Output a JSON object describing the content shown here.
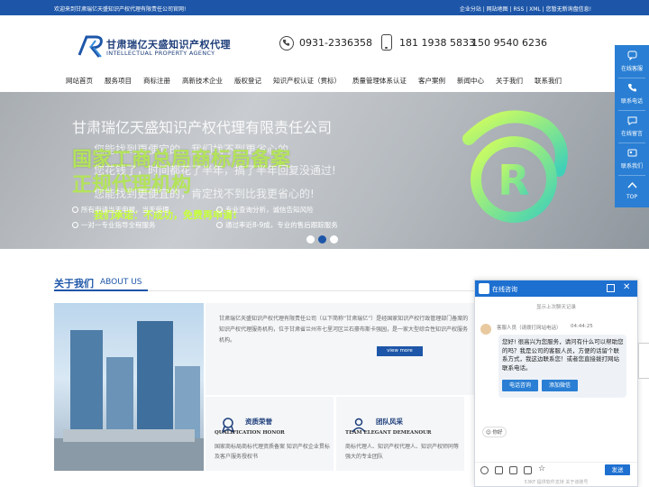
{
  "topbar": {
    "welcome": "欢迎来到甘肃瑞亿天盛知识产权代理有限责任公司官网!",
    "links": "企业分站 | 网站地图 | RSS | XML | 您暂无新询盘信息!"
  },
  "header": {
    "logo_cn": "甘肃瑞亿天盛知识产权代理",
    "logo_en": "INTELLECTUAL PROPERTY AGENCY",
    "phone1": "0931-2336358",
    "phone2": "181 1938 5833",
    "phone3": "150 9540 6236"
  },
  "nav": [
    "网站首页",
    "服务项目",
    "商标注册",
    "高新技术企业",
    "版权登记",
    "知识产权认证（贯标）",
    "质量管理体系认证",
    "客户案例",
    "新闻中心",
    "关于我们",
    "联系我们"
  ],
  "banner": {
    "line1": "甘肃瑞亿天盛知识产权代理有限责任公司",
    "line2": "国家工商总局商标局备案",
    "line3": "正规代理机构",
    "sub1": "您能找到更便宜的，我们找不到更省心的",
    "sub2": "您花钱了，时间都花了半年，搞了半年回复没通过!",
    "sub3": "您能找到更便宜的，肯定找不到比我更省心的!",
    "tag": "我们承诺：不成功，免费再申请!",
    "bullets": [
      "所有申请当天申报，当天受理",
      "专业查询分析，诚信告知风险",
      "一对一专业指导全程服务",
      "通过率近8-9成，专业的售后跟踪服务"
    ],
    "seal_text": "R",
    "slides": 3,
    "active_slide": 2
  },
  "about": {
    "title": "关于我们",
    "title_en": "ABOUT US",
    "text": "甘肃瑞亿天盛知识产权代理有限责任公司（以下简称“甘肃瑞亿”）是经国家知识产权行政管理部门备案的知识产权代理服务机构，位于甘肃省兰州市七里河区兰石豪布斯卡强园，是一家大型综合性知识产权服务机构。",
    "view_more": "view more",
    "cards": [
      {
        "title": "资质荣誉",
        "en": "QUALIFICATION HONOR",
        "desc": "国家商标局商标代理资质备案 知识产权企业贯标及客户服务授权书"
      },
      {
        "title": "团队风采",
        "en": "TEAM ELEGANT DEMEANOUR",
        "desc": "商标代理人、知识产权代理人、知识产权师同等强大的专业团队"
      }
    ]
  },
  "rightbar": [
    "在线客服",
    "联系电话",
    "在线留言",
    "联系我们",
    "TOP"
  ],
  "chat": {
    "title": "在线咨询",
    "history": "显示上次聊天记录",
    "agent": "客服人员（请拨打网站电话）",
    "time": "04:44:25",
    "message": "您好! 很高兴为您服务，请问有什么可以帮助您的吗？我是公司的客服人员，方便的话留个联系方式，我这边联系您！或者您直接拨打网站联系电话。",
    "btn1": "电话咨询",
    "btn2": "添加微信",
    "quick": "你好",
    "send": "发送",
    "powered": "53KF 提供软件支持  关于该账号"
  },
  "colors": {
    "primary": "#1d56a8",
    "accent_green": "#b3e35a",
    "chat_blue": "#1d6fd0"
  }
}
